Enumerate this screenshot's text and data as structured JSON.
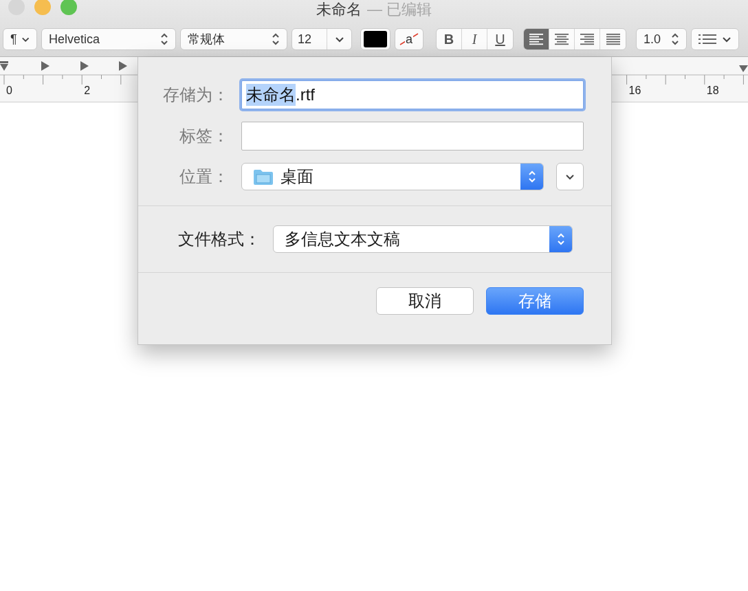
{
  "window": {
    "title": "未命名",
    "subtitle": "— 已编辑",
    "traffic_lights": [
      {
        "color": "#d6d6d6"
      },
      {
        "color": "#f5bd4f"
      },
      {
        "color": "#5fc453"
      }
    ]
  },
  "toolbar": {
    "paragraph": "¶",
    "font": "Helvetica",
    "style": "常规体",
    "size": "12",
    "background_letter": "a",
    "bold": "B",
    "italic": "I",
    "underline": "U",
    "alignments": [
      {
        "kind": "left",
        "selected": true
      },
      {
        "kind": "center",
        "selected": false
      },
      {
        "kind": "right",
        "selected": false
      },
      {
        "kind": "justify",
        "selected": false
      }
    ],
    "spacing": "1.0"
  },
  "ruler": {
    "labels": [
      "0",
      "2",
      "16",
      "18"
    ]
  },
  "save_dialog": {
    "save_as": {
      "label": "存储为：",
      "parts": [
        {
          "text": "未命名",
          "selected": true
        },
        {
          "text": ".rtf",
          "selected": false
        }
      ]
    },
    "tags": {
      "label": "标签："
    },
    "where": {
      "label": "位置：",
      "value": "桌面"
    },
    "file_format": {
      "label": "文件格式：",
      "value": "多信息文本文稿"
    },
    "buttons": [
      {
        "label": "取消",
        "default": false
      },
      {
        "label": "存储",
        "default": true
      }
    ]
  }
}
